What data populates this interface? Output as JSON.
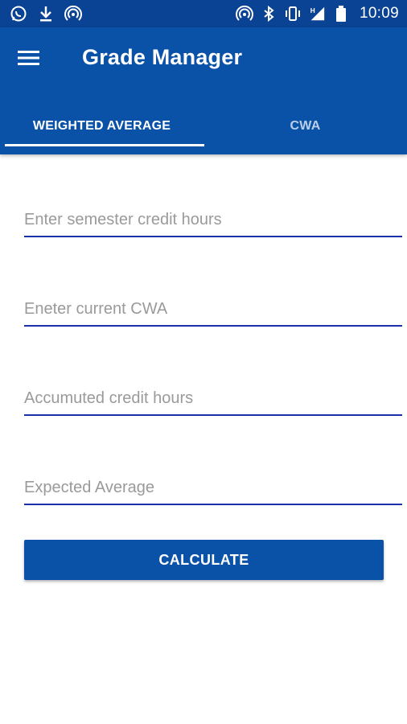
{
  "status_bar": {
    "left_icons": [
      "whatsapp-icon",
      "download-icon",
      "hotspot-icon"
    ],
    "right_icons": [
      "hotspot-icon",
      "bluetooth-icon",
      "vibrate-icon",
      "signal-icon",
      "battery-icon"
    ],
    "signal_label": "H",
    "time": "10:09"
  },
  "app_bar": {
    "menu_icon": "hamburger-menu-icon",
    "title": "Grade Manager"
  },
  "tabs": [
    {
      "label": "WEIGHTED AVERAGE",
      "active": true
    },
    {
      "label": "CWA",
      "active": false
    }
  ],
  "form": {
    "fields": [
      {
        "placeholder": "Enter semester credit hours",
        "value": ""
      },
      {
        "placeholder": "Eneter current CWA",
        "value": ""
      },
      {
        "placeholder": "Accumuted credit hours",
        "value": ""
      },
      {
        "placeholder": "Expected Average",
        "value": ""
      }
    ],
    "submit_label": "CALCULATE"
  },
  "colors": {
    "status_bar": "#0a4393",
    "primary": "#0a52a8",
    "input_underline": "#1a2fa8",
    "background": "#ffffff"
  }
}
